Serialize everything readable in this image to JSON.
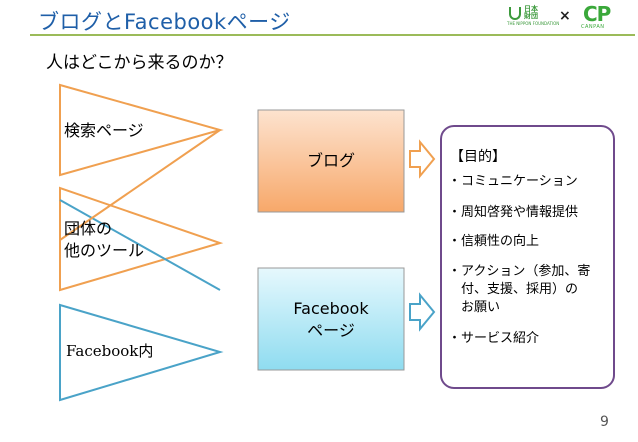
{
  "title": "ブログとFacebookページ",
  "subtitle": "人はどこから来るのか？",
  "logos": {
    "nippon_kanji": "日本財団",
    "nippon_en": "THE NIPPON FOUNDATION",
    "separator": "×",
    "canpan_mark": "CP",
    "canpan_text": "CANPAN"
  },
  "sources": [
    {
      "label": "検索ページ"
    },
    {
      "label": "団体の\n他のツール"
    },
    {
      "label": "Facebook内"
    }
  ],
  "targets": [
    {
      "label": "ブログ",
      "color": "#f7a86a"
    },
    {
      "label": "Facebook\nページ",
      "color": "#8fdcf0"
    }
  ],
  "purpose": {
    "heading": "【目的】",
    "items": [
      "・コミュニケーション",
      "・周知啓発や情報提供",
      "・信頼性の向上",
      "・アクション（参加、寄\n　付、支援、採用）の\n　お願い",
      "・サービス紹介"
    ]
  },
  "page_number": "9",
  "colors": {
    "title": "#1f5fa8",
    "rule": "#9bbb59",
    "orange_line": "#f0a050",
    "blue_line": "#4aa3c8",
    "purpose_border": "#6f4a8c"
  }
}
